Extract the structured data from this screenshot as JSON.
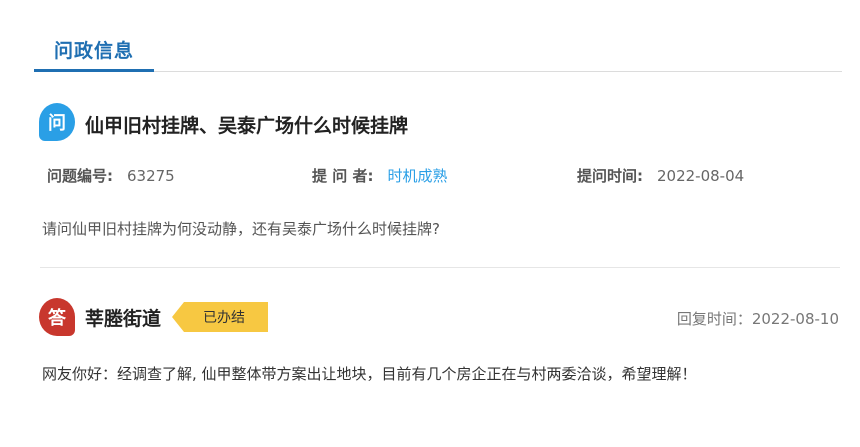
{
  "tabs": {
    "active_label": "问政信息"
  },
  "question": {
    "badge": "问",
    "title": "仙甲旧村挂牌、吴泰广场什么时候挂牌",
    "meta": {
      "id_label": "问题编号:",
      "id_value": "63275",
      "asker_label": "提 问 者:",
      "asker_value": "时机成熟",
      "time_label": "提问时间:",
      "time_value": "2022-08-04"
    },
    "body": "请问仙甲旧村挂牌为何没动静，还有吴泰广场什么时候挂牌?"
  },
  "answer": {
    "badge": "答",
    "department": "莘塍街道",
    "status": "已办结",
    "reply_time": "回复时间：2022-08-10",
    "body": "网友你好：经调查了解, 仙甲整体带方案出让地块，目前有几个房企正在与村两委洽谈，希望理解！"
  },
  "colors": {
    "accent": "#1f6fb2",
    "ask_badge": "#2a9fe6",
    "answer_badge": "#c8372d",
    "status_tag": "#f7c842"
  }
}
